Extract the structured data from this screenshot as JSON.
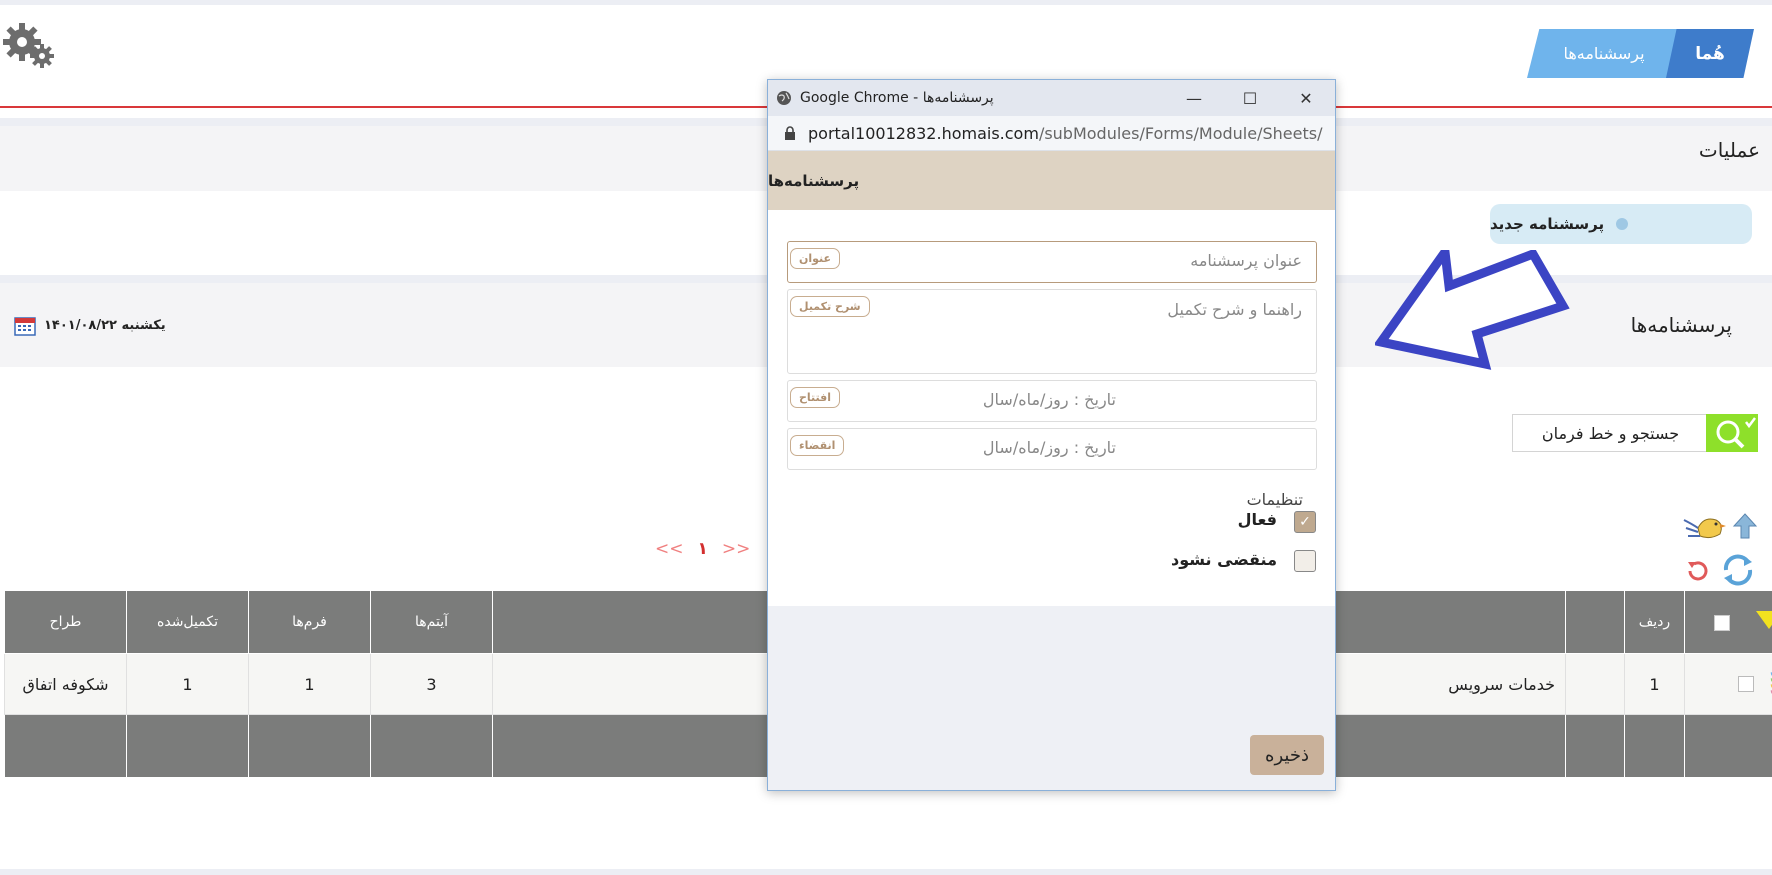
{
  "breadcrumb": {
    "home": "هُما",
    "forms": "پرسشنامه‌ها"
  },
  "operations": {
    "title": "عملیات",
    "new_button": "پرسشنامه جدید"
  },
  "forms_section": {
    "title": "پرسشنامه‌ها",
    "date": "یکشنبه ۱۴۰۱/۰۸/۲۲"
  },
  "search": {
    "placeholder": "جستجو و خط فرمان"
  },
  "pager": {
    "prev": "<<",
    "current": "۱",
    "next": ">>"
  },
  "table": {
    "headers": {
      "row": "ردیف",
      "items": "آیتم‌ها",
      "forms": "فرم‌ها",
      "completed": "تکمیل‌شده",
      "designer": "طراح"
    },
    "rows": [
      {
        "row": "1",
        "title": "خدمات سرویس",
        "items": "3",
        "forms": "1",
        "completed": "1",
        "designer": "شکوفه اتفاق"
      }
    ]
  },
  "popup": {
    "window_title": "Google Chrome - پرسشنامه‌ها",
    "url_host": "portal10012832.homais.com",
    "url_path": "/subModules/Forms/Module/Sheets/",
    "header": "پرسشنامه‌ها",
    "fields": {
      "title": {
        "placeholder": "عنوان پرسشنامه",
        "tag": "عنوان"
      },
      "desc": {
        "placeholder": "راهنما و شرح تکمیل",
        "tag": "شرح تکمیل"
      },
      "open": {
        "placeholder": "تاریخ : روز/ماه/سال",
        "tag": "افتتاح"
      },
      "expire": {
        "placeholder": "تاریخ : روز/ماه/سال",
        "tag": "انقضاء"
      }
    },
    "settings_label": "تنظیمات",
    "active_label": "فعال",
    "active_checked": true,
    "noexpire_label": "منقضی نشود",
    "noexpire_checked": false,
    "save_label": "ذخیره",
    "controls": {
      "minimize": "—",
      "maximize": "☐",
      "close": "✕"
    }
  },
  "colors": {
    "accent_blue": "#3e7ccb",
    "light_blue": "#6fb4ec",
    "header_red": "#d9383a",
    "table_header": "#7b7c7b",
    "popup_header": "#ded3c3",
    "save_button": "#c9b19a",
    "arrow": "#3b44c4"
  }
}
